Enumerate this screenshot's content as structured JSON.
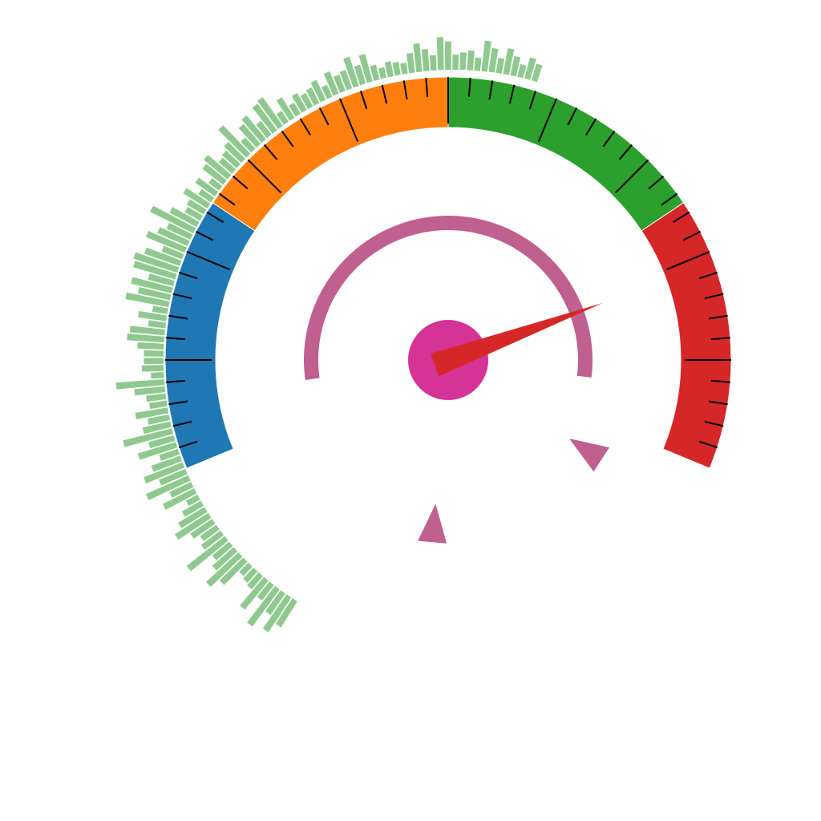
{
  "chart_data": {
    "type": "gauge",
    "title": "",
    "scale": {
      "min": 0,
      "max": 100,
      "major_step": 10,
      "minor_step": 2
    },
    "bands": [
      {
        "from": 0,
        "to": 25,
        "color": "#1f77b4"
      },
      {
        "from": 25,
        "to": 50,
        "color": "#ff7f0e"
      },
      {
        "from": 50,
        "to": 75,
        "color": "#2ca02c"
      },
      {
        "from": 75,
        "to": 100,
        "color": "#d62728"
      }
    ],
    "needle": {
      "value": 81,
      "color": "#d62728"
    },
    "hub_color": "#d63396",
    "inner_ring": {
      "from": 28,
      "to": 62,
      "color": "#c06090",
      "markers": [
        38,
        52
      ]
    },
    "outer_bars": {
      "color": "#90c990",
      "values": [
        0.55,
        0.8,
        0.45,
        0.9,
        0.3,
        0.7,
        0.25,
        0.2,
        0.15,
        0.6,
        0.85,
        0.5,
        0.35,
        0.95,
        0.4,
        0.3,
        0.45,
        0.75,
        0.55,
        0.35,
        0.15,
        0.65,
        0.4,
        0.9,
        0.5,
        0.8,
        0.55,
        0.3,
        0.75,
        0.45,
        1.0,
        0.5,
        0.35,
        0.6,
        0.25,
        0.3,
        0.55,
        0.95,
        0.15,
        0.35,
        0.3,
        0.3,
        0.45,
        0.7,
        0.65,
        0.25,
        0.5,
        0.2,
        0.85,
        0.6,
        0.8,
        0.45,
        0.85,
        0.9,
        0.7,
        0.35,
        0.8,
        0.6,
        0.45,
        0.95,
        0.55,
        0.25,
        0.3,
        0.5,
        0.2,
        0.4,
        0.15,
        0.45,
        0.55,
        0.25,
        0.3,
        0.4,
        0.75,
        0.2,
        0.45,
        0.55,
        0.25,
        0.6,
        0.65,
        0.15,
        0.4,
        0.15,
        0.3,
        0.2,
        0.25,
        0.35,
        0.15,
        0.4,
        0.25,
        0.3,
        0.55,
        0.3,
        0.5,
        0.2,
        0.1,
        0.2,
        0.15,
        0.1,
        0.3,
        0.5,
        0.35,
        0.2,
        0.6,
        0.5,
        0.2,
        0.25,
        0.3,
        0.15,
        0.55,
        0.4,
        0.2,
        0.45,
        0.3,
        0.15,
        0.35,
        0.25
      ]
    }
  }
}
